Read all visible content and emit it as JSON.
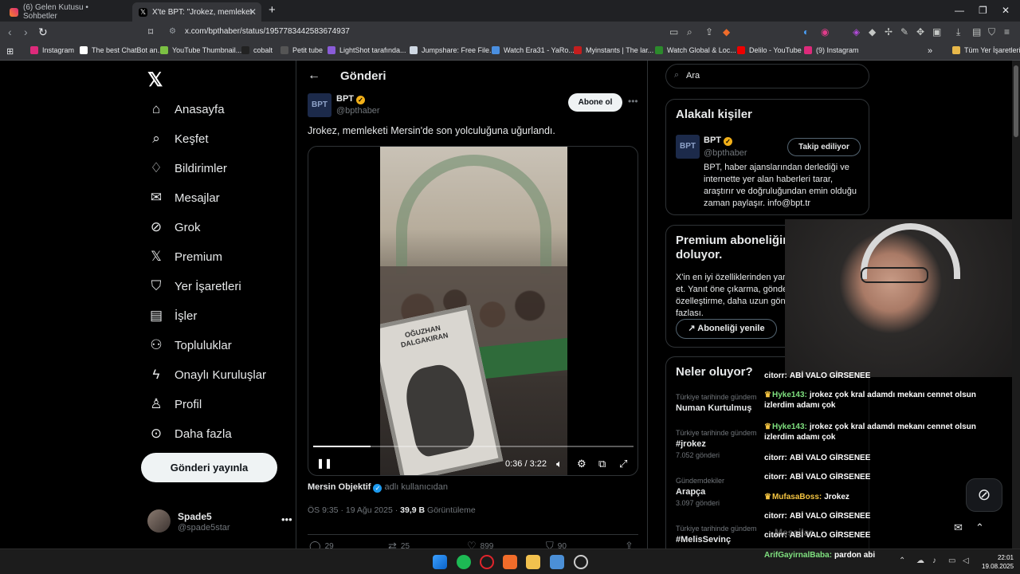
{
  "browser": {
    "tabs": [
      {
        "title": "(6) Gelen Kutusu • Sohbetler",
        "active": false
      },
      {
        "title": "X'te BPT: \"Jrokez, memleketi Me...",
        "active": true
      }
    ],
    "url": "x.com/bpthaber/status/1957783442583674937",
    "bookmarks": [
      "Instagram",
      "The best ChatBot an...",
      "YouTube Thumbnail...",
      "cobalt",
      "Petit tube",
      "LightShot tarafında...",
      "Jumpshare: Free File...",
      "Watch Era31 - YaRo...",
      "Myinstants | The lar...",
      "Watch Global & Loc...",
      "Delilo - YouTube",
      "(9) Instagram"
    ],
    "all_bookmarks": "Tüm Yer İşaretleri"
  },
  "nav": {
    "items": [
      "Anasayfa",
      "Keşfet",
      "Bildirimler",
      "Mesajlar",
      "Grok",
      "Premium",
      "Yer İşaretleri",
      "İşler",
      "Topluluklar",
      "Onaylı Kuruluşlar",
      "Profil",
      "Daha fazla"
    ],
    "post_button": "Gönderi yayınla",
    "me": {
      "name": "Spade5",
      "handle": "@spade5star"
    }
  },
  "post": {
    "header": "Gönderi",
    "author": {
      "name": "BPT",
      "handle": "@bpthaber",
      "avatar_text": "BPT"
    },
    "follow_label": "Abone ol",
    "text": "Jrokez, memleketi Mersin'de son yolculuğuna uğurlandı.",
    "video": {
      "time": "0:36 / 3:22",
      "progress": 0.18,
      "portrait_name": "OĞUZHAN DALGAKIRAN"
    },
    "source_user": "Mersin Objektif",
    "source_suffix": "adlı kullanıcıdan",
    "timestamp": "ÖS 9:35 · 19 Ağu 2025 ·",
    "views": "39,9 B",
    "views_label": "Görüntüleme",
    "replies": "29",
    "reposts": "25",
    "likes": "899",
    "bookmarks": "90"
  },
  "right": {
    "search_placeholder": "Ara",
    "related_title": "Alakalı kişiler",
    "related": {
      "name": "BPT",
      "handle": "@bpthaber",
      "following_label": "Takip ediliyor",
      "bio": "BPT, haber ajanslarından derlediği ve internette yer alan haberleri tarar, araştırır ve doğruluğundan emin olduğu zaman paylaşır. info@bpt.tr"
    },
    "premium_title": "Premium aboneliğinin süresi doluyor.",
    "premium_text": "X'in en iyi özelliklerinden yararlanmaya deva et. Yanıt öne çıkarma, gönderi düzenlem özelleştirme, daha uzun gönderiler v daha fazlası.",
    "renew_label": "Aboneliği yenile",
    "trends_title": "Neler oluyor?",
    "trends": [
      {
        "context": "Türkiye tarihinde gündem",
        "name": "Numan Kurtulmuş",
        "posts": ""
      },
      {
        "context": "Türkiye tarihinde gündem",
        "name": "#jrokez",
        "posts": "7.052 gönderi"
      },
      {
        "context": "Gündemdekiler",
        "name": "Arapça",
        "posts": "3.097 gönderi"
      },
      {
        "context": "Türkiye tarihinde gündem",
        "name": "#MelisSevinç",
        "posts": ""
      }
    ],
    "messages_label": "Mesajlar"
  },
  "chat": [
    {
      "user": "citorr:",
      "text": "ABİ VALO GİRSENEE",
      "color": "#ffffff",
      "crown": false
    },
    {
      "user": "Hyke143:",
      "text": "jrokez çok kral adamdı mekanı cennet olsun izlerdim adamı çok",
      "color": "#7fe07f",
      "crown": true
    },
    {
      "user": "Hyke143:",
      "text": "jrokez çok kral adamdı mekanı cennet olsun izlerdim adamı çok",
      "color": "#7fe07f",
      "crown": true
    },
    {
      "user": "citorr:",
      "text": "ABİ VALO GİRSENEE",
      "color": "#ffffff",
      "crown": false
    },
    {
      "user": "citorr:",
      "text": "ABİ VALO GİRSENEE",
      "color": "#ffffff",
      "crown": false
    },
    {
      "user": "MufasaBoss:",
      "text": "Jrokez",
      "color": "#f5c542",
      "crown": true
    },
    {
      "user": "citorr:",
      "text": "ABİ VALO GİRSENEE",
      "color": "#ffffff",
      "crown": false
    },
    {
      "user": "citorr:",
      "text": "ABİ VALO GİRSENEE",
      "color": "#ffffff",
      "crown": false
    },
    {
      "user": "ArifGayirnalBaba:",
      "text": "pardon abi",
      "color": "#7fe07f",
      "crown": false
    }
  ],
  "taskbar": {
    "time": "22:01",
    "date": "19.08.2025"
  },
  "colors": {
    "accent": "#1d9bf0",
    "background": "#000000",
    "border": "#2f3336",
    "muted": "#71767b"
  }
}
